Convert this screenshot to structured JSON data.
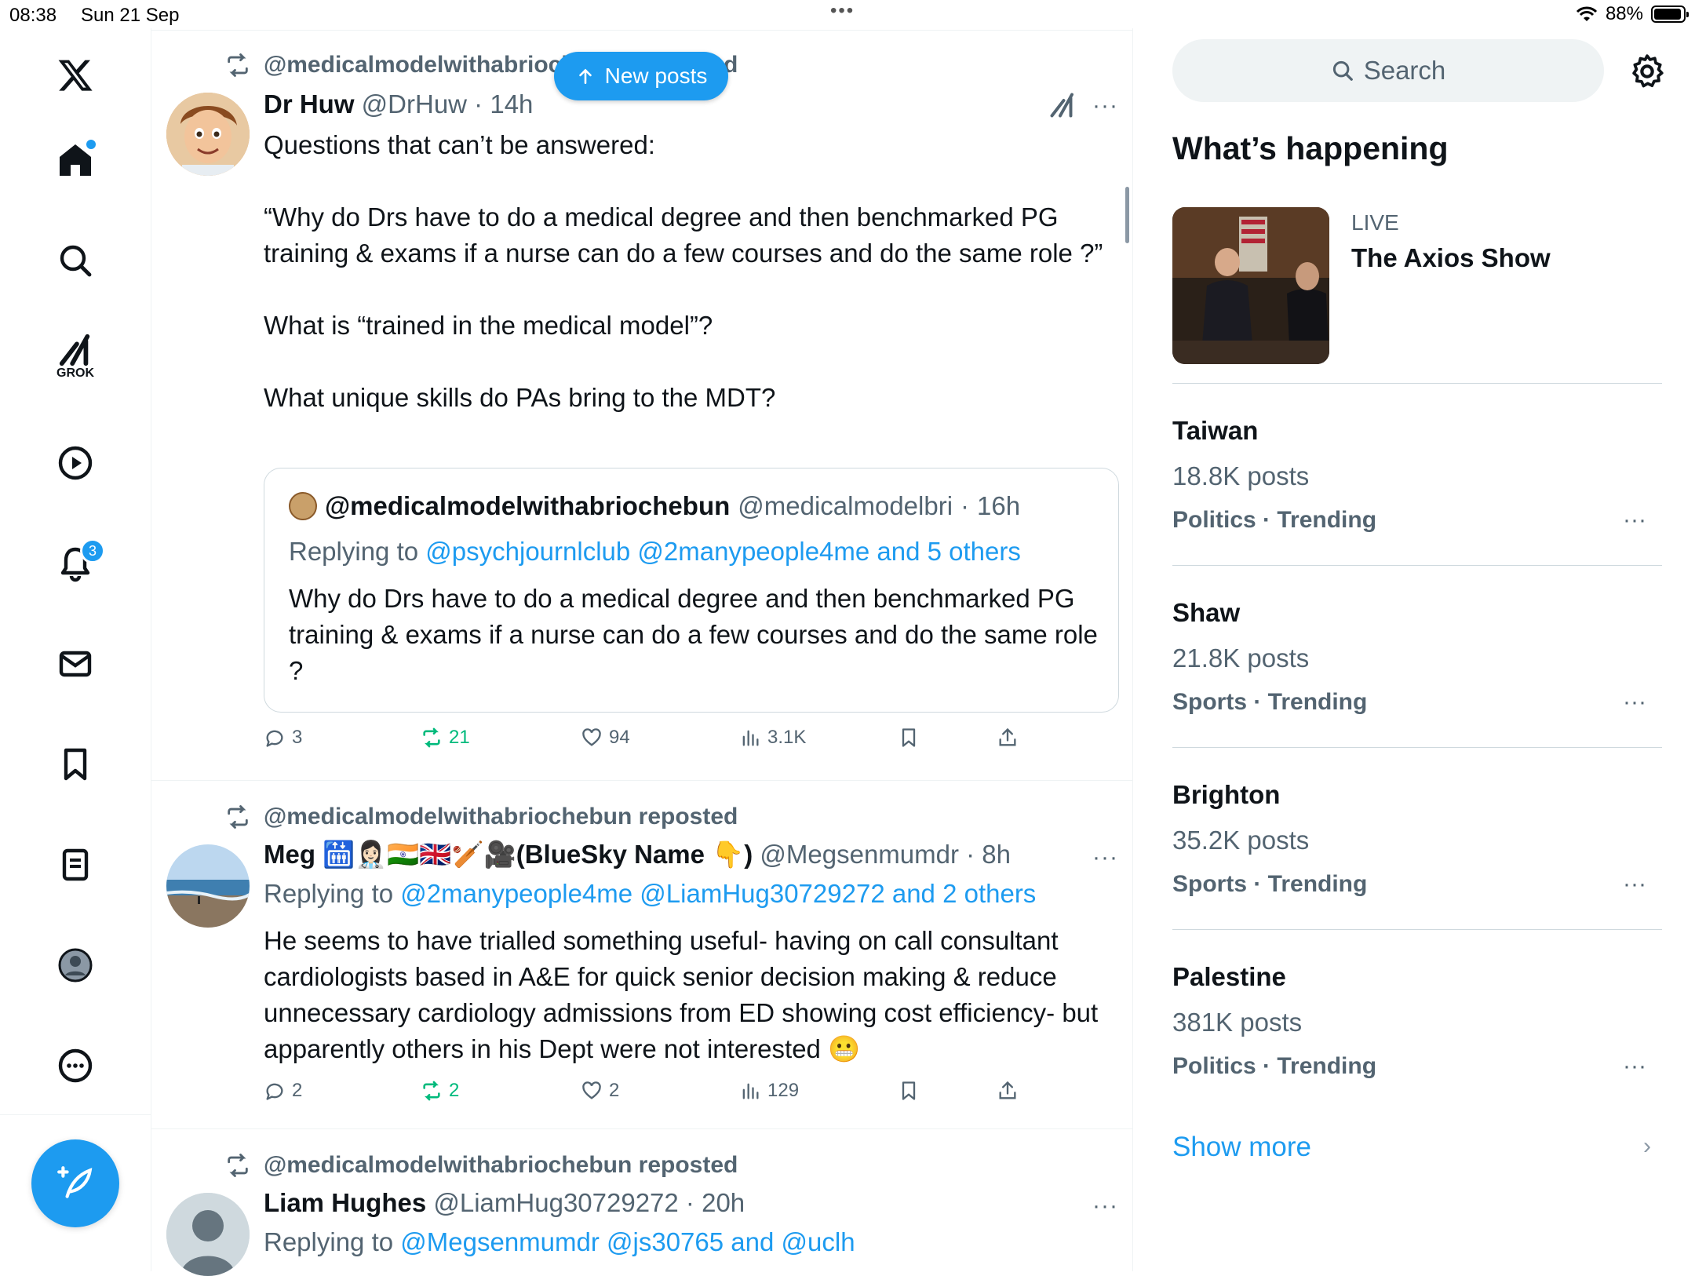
{
  "status_bar": {
    "time": "08:38",
    "date": "Sun 21 Sep",
    "battery": "88%",
    "multitask_dots": "•••"
  },
  "nav": {
    "logo": "X",
    "items": [
      {
        "name": "home",
        "icon": "home-icon"
      },
      {
        "name": "explore",
        "icon": "search-icon"
      },
      {
        "name": "grok",
        "icon": "grok-icon",
        "label": "GROK"
      },
      {
        "name": "videos",
        "icon": "play-icon"
      },
      {
        "name": "notifications",
        "icon": "bell-icon",
        "badge": "3"
      },
      {
        "name": "messages",
        "icon": "mail-icon"
      },
      {
        "name": "bookmarks",
        "icon": "bookmark-icon"
      },
      {
        "name": "lists",
        "icon": "list-icon"
      },
      {
        "name": "profile",
        "icon": "profile-icon"
      },
      {
        "name": "more",
        "icon": "more-circle-icon"
      }
    ]
  },
  "new_posts_button": "New posts",
  "posts": [
    {
      "repost_by": "@medicalmodelwithabriochebun reposted",
      "display_name": "Dr Huw",
      "handle": "@DrHuw",
      "time": "14h",
      "text": "Questions that can’t be answered:\n\n“Why do Drs have to do a medical degree and then benchmarked PG training & exams if a nurse can do a few courses and do the same role ?”\n\nWhat is “trained in the medical model”?\n\nWhat unique skills do PAs bring to the MDT?",
      "quote": {
        "display_name": "@medicalmodelwithabriochebun",
        "handle": "@medicalmodelbri",
        "time": "16h",
        "replying_prefix": "Replying to",
        "replying_to": "@psychjournlclub @2manypeople4me and 5 others",
        "text": "Why do Drs have to do a medical degree and then benchmarked PG training & exams if a nurse can do a few courses and do the same role ?"
      },
      "stats": {
        "replies": "3",
        "reposts": "21",
        "likes": "94",
        "views": "3.1K"
      }
    },
    {
      "repost_by": "@medicalmodelwithabriochebun reposted",
      "display_name": "Meg 🛗👩🏻‍⚕️🇮🇳🇬🇧🏏🎥(BlueSky Name 👇)",
      "handle": "@Megsenmumdr",
      "time": "8h",
      "replying_prefix": "Replying to",
      "replying_to": "@2manypeople4me @LiamHug30729272 and 2 others",
      "text": "He seems to have trialled something useful- having on call consultant cardiologists based in A&E for quick senior decision making & reduce unnecessary cardiology admissions from ED showing cost efficiency- but apparently others in his Dept were not interested 😬",
      "stats": {
        "replies": "2",
        "reposts": "2",
        "likes": "2",
        "views": "129"
      }
    },
    {
      "repost_by": "@medicalmodelwithabriochebun reposted",
      "display_name": "Liam Hughes",
      "handle": "@LiamHug30729272",
      "time": "20h",
      "replying_prefix": "Replying to",
      "replying_to": "@Megsenmumdr @js30765 and @uclh"
    }
  ],
  "sidebar": {
    "search_placeholder": "Search",
    "title": "What’s happening",
    "live": {
      "tag": "LIVE",
      "title": "The Axios Show"
    },
    "trends": [
      {
        "name": "Taiwan",
        "count": "18.8K posts",
        "category": "Politics · Trending"
      },
      {
        "name": "Shaw",
        "count": "21.8K posts",
        "category": "Sports · Trending"
      },
      {
        "name": "Brighton",
        "count": "35.2K posts",
        "category": "Sports · Trending"
      },
      {
        "name": "Palestine",
        "count": "381K posts",
        "category": "Politics · Trending"
      }
    ],
    "show_more": "Show more"
  },
  "colors": {
    "accent": "#1d9bf0",
    "repost_green": "#00ba7c",
    "secondary_text": "#536471"
  }
}
